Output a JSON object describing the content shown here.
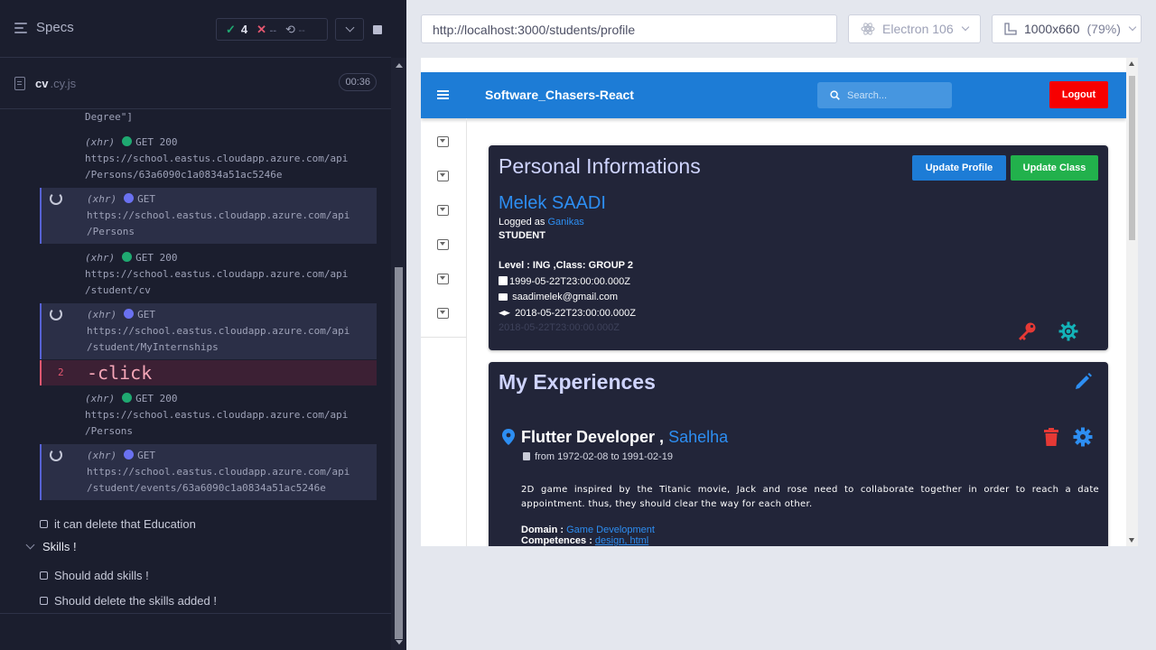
{
  "reporter": {
    "specs_label": "Specs",
    "stats": {
      "passed": "4",
      "failed": "--",
      "pending": "--"
    },
    "spec": {
      "name": "cv",
      "ext": ".cy.js",
      "time": "00:36"
    },
    "commands": [
      {
        "text_lines": [
          "Degree\"]"
        ]
      },
      {
        "method": "(xhr)",
        "verb": "GET 200",
        "dot": "green",
        "lines": [
          "https://school.eastus.cloudapp.azure.com/api",
          "/Persons/63a6090c1a0834a51ac5246e"
        ],
        "pending": false
      },
      {
        "method": "(xhr)",
        "verb": "GET",
        "dot": "blue",
        "lines": [
          "https://school.eastus.cloudapp.azure.com/api",
          "/Persons"
        ],
        "pending": true
      },
      {
        "method": "(xhr)",
        "verb": "GET 200",
        "dot": "green",
        "lines": [
          "https://school.eastus.cloudapp.azure.com/api",
          "/student/cv"
        ],
        "pending": false
      },
      {
        "method": "(xhr)",
        "verb": "GET",
        "dot": "blue",
        "lines": [
          "https://school.eastus.cloudapp.azure.com/api",
          "/student/MyInternships"
        ],
        "pending": true
      },
      {
        "num": "2",
        "name": "-click"
      },
      {
        "method": "(xhr)",
        "verb": "GET 200",
        "dot": "green",
        "lines": [
          "https://school.eastus.cloudapp.azure.com/api",
          "/Persons"
        ],
        "pending": false
      },
      {
        "method": "(xhr)",
        "verb": "GET",
        "dot": "blue",
        "lines": [
          "https://school.eastus.cloudapp.azure.com/api",
          "/student/events/63a6090c1a0834a51ac5246e"
        ],
        "pending": true
      }
    ],
    "tests": {
      "delete_education": "it can delete that Education",
      "suite_skills": "Skills !",
      "add_skills": "Should add skills !",
      "delete_skills": "Should delete the skills added !"
    }
  },
  "runner": {
    "url": "http://localhost:3000/students/profile",
    "browser": "Electron 106",
    "viewport": "1000x660",
    "scale": "(79%)"
  },
  "app": {
    "brand": "Software_Chasers-React",
    "search_placeholder": "Search...",
    "logout": "Logout",
    "personal": {
      "title": "Personal Informations",
      "update_profile": "Update Profile",
      "update_class": "Update Class",
      "name": "Melek SAADI",
      "logged_as_prefix": "Logged as",
      "username": "Ganikas",
      "role": "STUDENT",
      "level_class": "Level : ING ,Class: GROUP 2",
      "birth": "1999-05-22T23:00:00.000Z",
      "email": "saadimelek@gmail.com",
      "grad": "2018-05-22T23:00:00.000Z",
      "ghost": "2018-05-22T23:00:00.000Z"
    },
    "experiences": {
      "title": "My Experiences",
      "job": "Flutter Developer ,",
      "company": "Sahelha",
      "dates": "from 1972-02-08 to 1991-02-19",
      "description": "2D game inspired by the Titanic movie, Jack and rose need to collaborate together in order to reach a date appointment. thus, they should clear the way for each other.",
      "domain_label": "Domain :",
      "domain": "Game Development",
      "competences_label": "Competences :",
      "competences": "design, html"
    }
  },
  "colors": {
    "reporter_bg": "#1b1e2e",
    "appbar": "#1d7cd6",
    "logout": "#f70000",
    "update_profile": "#1d7cd6",
    "update_class": "#22b14c",
    "card": "#222539",
    "link": "#2d8ef2",
    "key_icon": "#e53935",
    "gear_icon": "#13b3b8"
  }
}
